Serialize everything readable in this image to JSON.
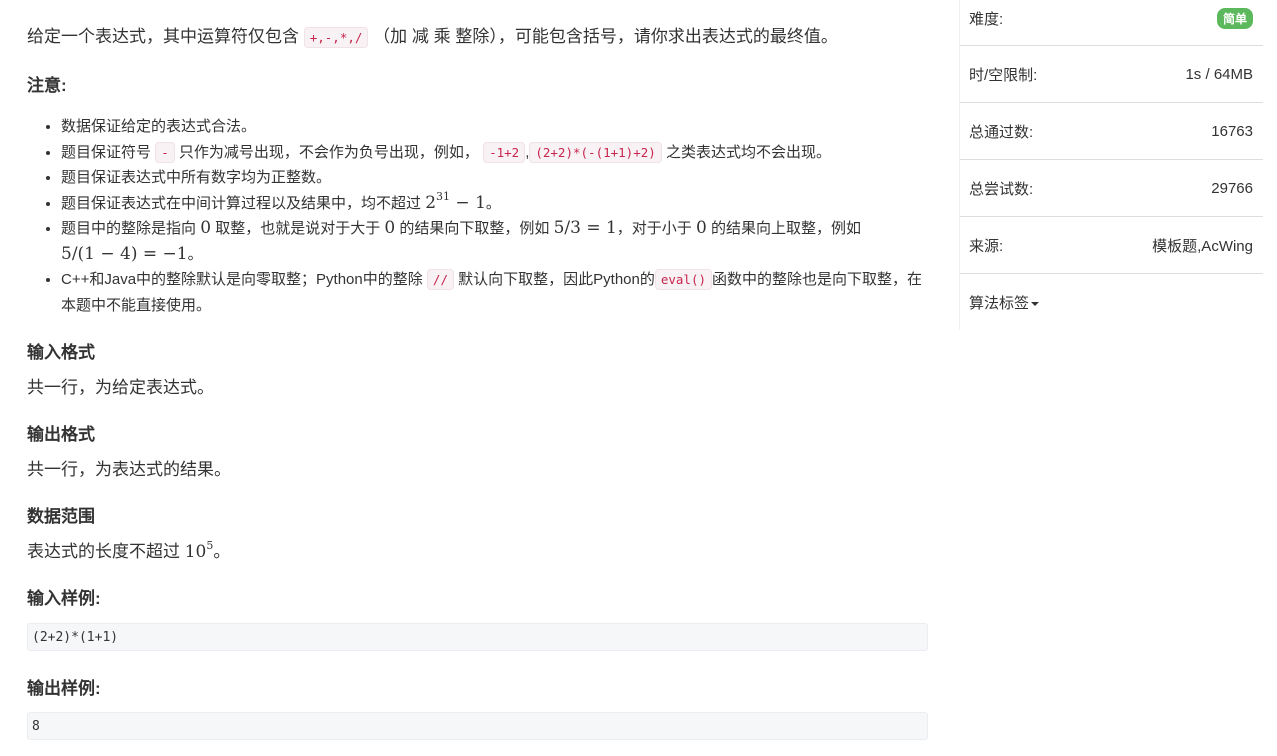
{
  "problem": {
    "intro": {
      "before": "给定一个表达式，其中运算符仅包含",
      "ops_code": "+,-,*,/",
      "after": "（加 减 乘 整除），可能包含括号，请你求出表达式的最终值。"
    },
    "notes_title": "注意:",
    "notes": {
      "n1": "数据保证给定的表达式合法。",
      "n2_a": "题目保证符号",
      "n2_code1": "-",
      "n2_b": "只作为减号出现，不会作为负号出现，例如，",
      "n2_code2": "-1+2",
      "n2_comma": ",",
      "n2_code3": "(2+2)*(-(1+1)+2)",
      "n2_c": "之类表达式均不会出现。",
      "n3": "题目保证表达式中所有数字均为正整数。",
      "n4_a": "题目保证表达式在中间计算过程以及结果中，均不超过",
      "n4_base": "2",
      "n4_exp": "31",
      "n4_tail": " − 1",
      "n4_end": "。",
      "n5_a": "题目中的整除是指向",
      "n5_zero1": "0",
      "n5_b": "取整，也就是说对于大于",
      "n5_zero2": "0",
      "n5_c": "的结果向下取整，例如",
      "n5_ex1": "5/3 = 1",
      "n5_d": "，对于小于",
      "n5_zero3": "0",
      "n5_e": "的结果向上取整，例如",
      "n5_ex2": "5/(1 − 4) = −1",
      "n5_end": "。",
      "n6_a": "C++和Java中的整除默认是向零取整；Python中的整除",
      "n6_code1": "//",
      "n6_b": "默认向下取整，因此Python的",
      "n6_code2": "eval()",
      "n6_c": "函数中的整除也是向下取整，在本题中不能直接使用。"
    },
    "input_title": "输入格式",
    "input_text": "共一行，为给定表达式。",
    "output_title": "输出格式",
    "output_text": "共一行，为表达式的结果。",
    "range_title": "数据范围",
    "range_text": "表达式的长度不超过",
    "range_base": "10",
    "range_exp": "5",
    "range_end": "。",
    "sample_input_title": "输入样例:",
    "sample_input": "(2+2)*(1+1)",
    "sample_output_title": "输出样例:",
    "sample_output": "8"
  },
  "sidebar": {
    "difficulty_label": "难度:",
    "difficulty_value": "简单",
    "limit_label": "时/空限制:",
    "limit_value": "1s / 64MB",
    "passed_label": "总通过数:",
    "passed_value": "16763",
    "tried_label": "总尝试数:",
    "tried_value": "29766",
    "source_label": "来源:",
    "source_value": "模板题,AcWing",
    "tags_label": "算法标签"
  },
  "colors": {
    "badge_green": "#5cb85c",
    "code_red": "#c7254e",
    "code_bg": "#f9f2f4"
  }
}
